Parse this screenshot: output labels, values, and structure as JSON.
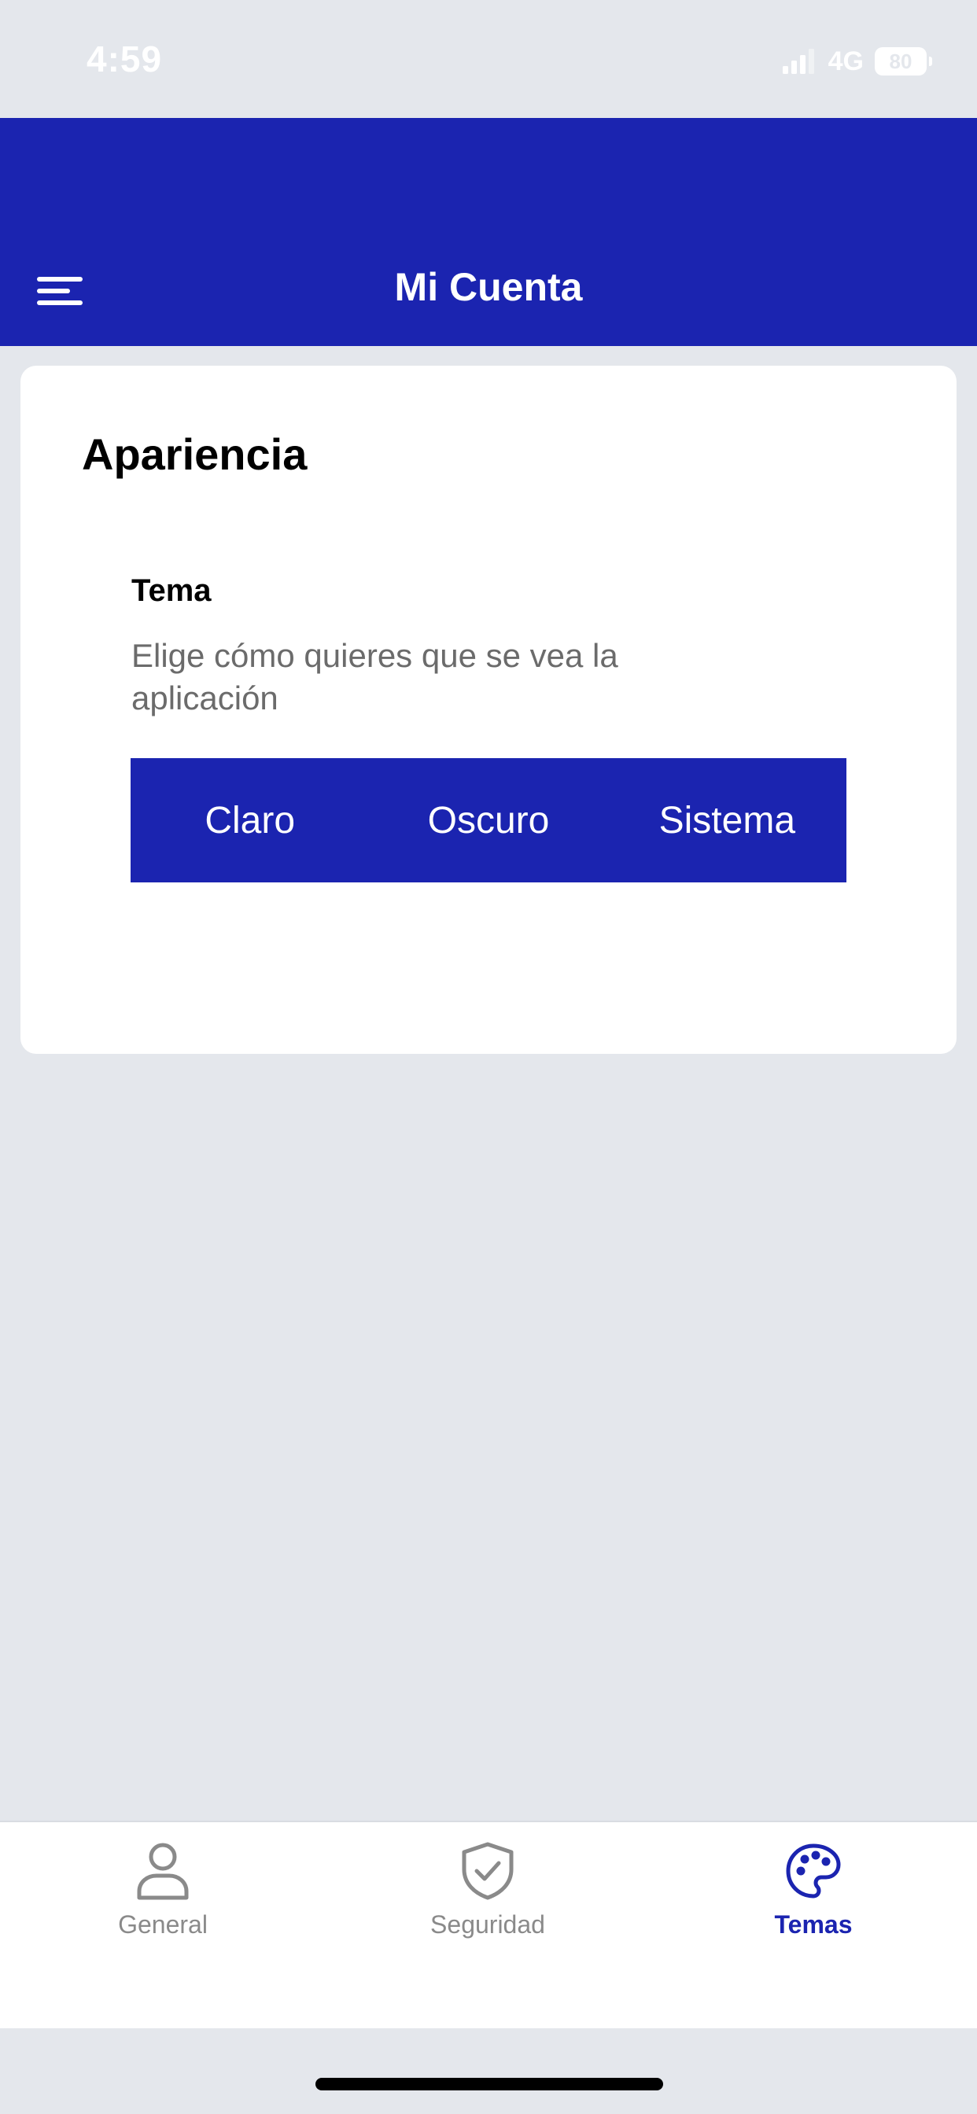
{
  "status_bar": {
    "time": "4:59",
    "network": "4G",
    "battery": "80",
    "icons": [
      "cellular-signal-icon",
      "battery-icon"
    ]
  },
  "header": {
    "title": "Mi Cuenta",
    "menu_icon": "hamburger-menu-icon",
    "background_color": "#1b24b0"
  },
  "appearance": {
    "section_title": "Apariencia",
    "theme_label": "Tema",
    "theme_description": "Elige cómo quieres que se vea la aplicación",
    "options": [
      "Claro",
      "Oscuro",
      "Sistema"
    ]
  },
  "tab_bar": {
    "tabs": [
      {
        "label": "General",
        "icon": "user-icon",
        "active": false
      },
      {
        "label": "Seguridad",
        "icon": "shield-check-icon",
        "active": false
      },
      {
        "label": "Temas",
        "icon": "palette-icon",
        "active": true
      }
    ],
    "active_color": "#1b24b0",
    "inactive_color": "#8a8a8a"
  }
}
